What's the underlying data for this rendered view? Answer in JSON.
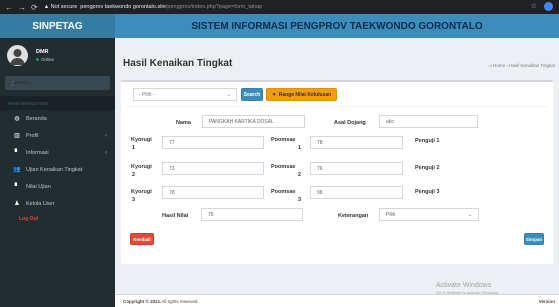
{
  "browser": {
    "warning": "▲ Not secure",
    "url_host": "pengprov taekwondo gorontalo.site",
    "url_path": "/pengprov/index.php?page=form_tahap",
    "icons": [
      "back-icon",
      "forward-icon",
      "reload-icon",
      "star-icon",
      "profile-icon"
    ]
  },
  "brand": "SINPETAG",
  "header_title": "SISTEM INFORMASI PENGPROV TAEKWONDO GORONTALO",
  "user": {
    "name": "DMR",
    "status": "Online"
  },
  "sidebar": {
    "search_placeholder": "Search...",
    "nav_header": "MAIN NAVIGATION",
    "items": [
      {
        "label": "Beranda",
        "icon": "dashboard-icon"
      },
      {
        "label": "Profil",
        "icon": "institution-icon"
      },
      {
        "label": "Informasi",
        "icon": "file-icon"
      },
      {
        "label": "Ujian Kenaikan Tingkat",
        "icon": "users-icon"
      },
      {
        "label": "Nilai Ujian",
        "icon": "file-text-icon"
      },
      {
        "label": "Kelola User",
        "icon": "user-icon"
      }
    ],
    "logout": "Log Out"
  },
  "page": {
    "title": "Hasil Kenaikan Tingkat",
    "breadcrumb_home": "Home",
    "breadcrumb_current": "Hasil Kenaikan Tingkat"
  },
  "filter": {
    "select_value": "- Pilih -",
    "search_button": "Search",
    "range_button": "Range Nilai Kelulusan"
  },
  "form": {
    "nama_label": "Nama",
    "nama_value": "PANGKAH KARTIKA DOSAL",
    "asal_label": "Asal Dojang",
    "asal_value": "abc",
    "kyorugi1_label": "Kyorugi",
    "kyorugi1_num": "1",
    "kyorugi1_value": "77",
    "poomsae1_label": "Poomsae",
    "poomsae1_num": "1",
    "poomsae1_value": "78",
    "penguji1_label": "Penguji 1",
    "kyorugi2_label": "Kyorugi",
    "kyorugi2_num": "2",
    "kyorugi2_value": "73",
    "poomsae2_label": "Poomsae",
    "poomsae2_num": "2",
    "poomsae2_value": "76",
    "penguji2_label": "Penguji 2",
    "kyorugi3_label": "Kyorugi",
    "kyorugi3_num": "3",
    "kyorugi3_value": "78",
    "poomsae3_label": "Poomsae",
    "poomsae3_num": "3",
    "poomsae3_value": "98",
    "penguji3_label": "Penguji 3",
    "hasil_label": "Hasil Nilai",
    "hasil_value": "75",
    "keterangan_label": "Keterangan",
    "keterangan_value": "Pilih"
  },
  "buttons": {
    "back": "Kembali",
    "save": "Simpan"
  },
  "footer": {
    "copyright": "Copyright © 2021.",
    "rights": " All rights reserved.",
    "version": "Version"
  },
  "watermark": {
    "line1": "Activate Windows",
    "line2": "Go to Settings to activate Windows."
  },
  "colors": {
    "header": "#3c8dbc",
    "brand": "#357ca5",
    "sidebar": "#222d32",
    "danger": "#dd4b39",
    "warning": "#f39c12"
  }
}
